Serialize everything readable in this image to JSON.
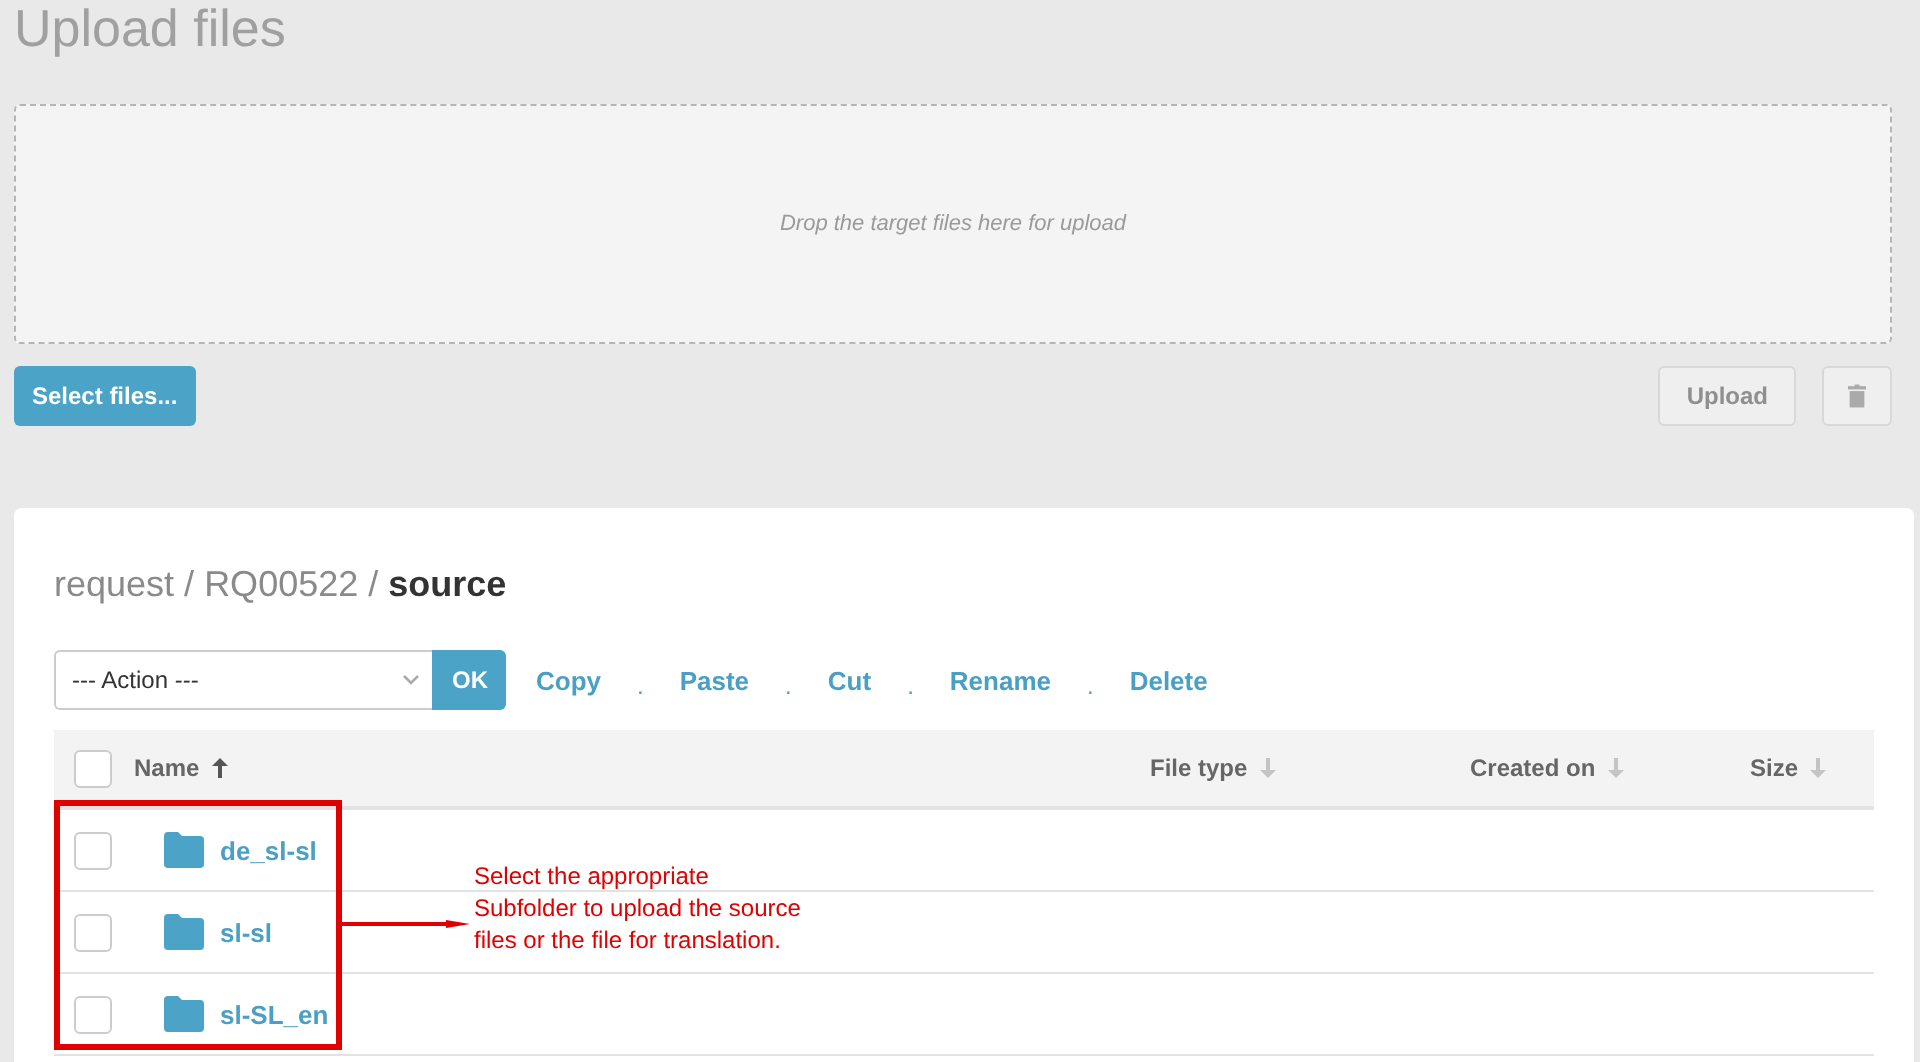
{
  "title": "Upload files",
  "dropzone": {
    "placeholder": "Drop the target files here for upload"
  },
  "select_button": "Select files...",
  "upload_button": {
    "label": "Upload",
    "disabled": true
  },
  "breadcrumb": [
    {
      "label": "request",
      "current": false
    },
    {
      "label": "RQ00522",
      "current": false
    },
    {
      "label": "source",
      "current": true
    }
  ],
  "breadcrumb_separator": "/",
  "action_select": {
    "value": "--- Action ---"
  },
  "ok_button": "OK",
  "actions": [
    "Copy",
    "Paste",
    "Cut",
    "Rename",
    "Delete"
  ],
  "action_separator": ".",
  "select_all": {
    "checked": false
  },
  "columns": [
    {
      "label": "Name",
      "sorted": true
    },
    {
      "label": "File type",
      "sorted": false
    },
    {
      "label": "Created on",
      "sorted": false
    },
    {
      "label": "Size",
      "sorted": false
    }
  ],
  "rows": [
    {
      "name": "de_sl-sl",
      "selected": false
    },
    {
      "name": "sl-sl",
      "selected": false
    },
    {
      "name": "sl-SL_en",
      "selected": false
    }
  ],
  "annotation": {
    "text": "Select the appropriate Subfolder to upload the source files or the file for translation."
  }
}
